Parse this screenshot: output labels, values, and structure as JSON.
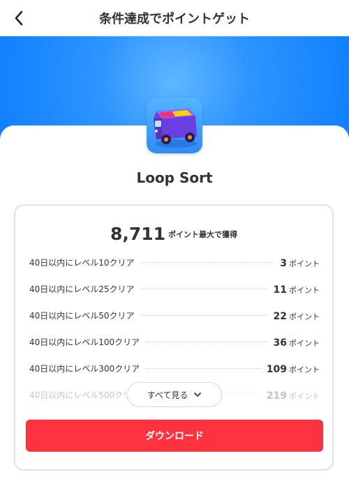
{
  "header": {
    "title": "条件達成でポイントゲット"
  },
  "app": {
    "name": "Loop Sort"
  },
  "reward": {
    "total_points": "8,711",
    "total_label": "ポイント最大で獲得",
    "tasks": [
      {
        "label": "40日以内にレベル10クリア",
        "points": "3",
        "unit": "ポイント"
      },
      {
        "label": "40日以内にレベル25クリア",
        "points": "11",
        "unit": "ポイント"
      },
      {
        "label": "40日以内にレベル50クリア",
        "points": "22",
        "unit": "ポイント"
      },
      {
        "label": "40日以内にレベル100クリア",
        "points": "36",
        "unit": "ポイント"
      },
      {
        "label": "40日以内にレベル300クリア",
        "points": "109",
        "unit": "ポイント"
      },
      {
        "label": "40日以内にレベル500クリア",
        "points": "219",
        "unit": "ポイント"
      }
    ],
    "see_all_label": "すべて見る",
    "download_label": "ダウンロード"
  },
  "colors": {
    "accent_red": "#ff3340",
    "hero_blue": "#1f8bff"
  },
  "icons": {
    "back": "chevron-left-icon",
    "see_all": "chevron-down-icon",
    "app": "toy-van-app-icon"
  }
}
